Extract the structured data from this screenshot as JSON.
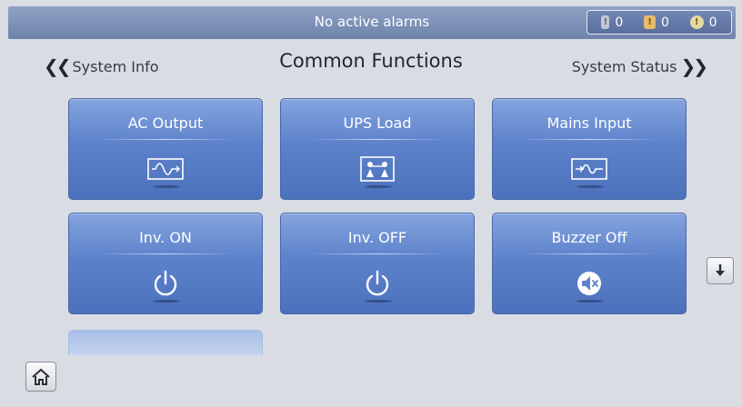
{
  "status_bar": {
    "alarm_text": "No active alarms",
    "counters": [
      {
        "icon": "critical-alarm-icon",
        "count": "0"
      },
      {
        "icon": "major-alarm-icon",
        "count": "0"
      },
      {
        "icon": "minor-alarm-icon",
        "count": "0"
      }
    ]
  },
  "nav": {
    "prev_label": "System Info",
    "title": "Common Functions",
    "next_label": "System Status"
  },
  "tiles": [
    {
      "label": "AC Output",
      "icon": "ac-output-icon"
    },
    {
      "label": "UPS Load",
      "icon": "ups-load-icon"
    },
    {
      "label": "Mains Input",
      "icon": "mains-input-icon"
    },
    {
      "label": "Inv. ON",
      "icon": "power-icon"
    },
    {
      "label": "Inv. OFF",
      "icon": "power-icon"
    },
    {
      "label": "Buzzer Off",
      "icon": "mute-icon"
    }
  ],
  "colors": {
    "tile_top": "#84a4de",
    "tile_bottom": "#4c71bc",
    "status_bar": "#7f92b9",
    "background": "#d9dde3"
  }
}
